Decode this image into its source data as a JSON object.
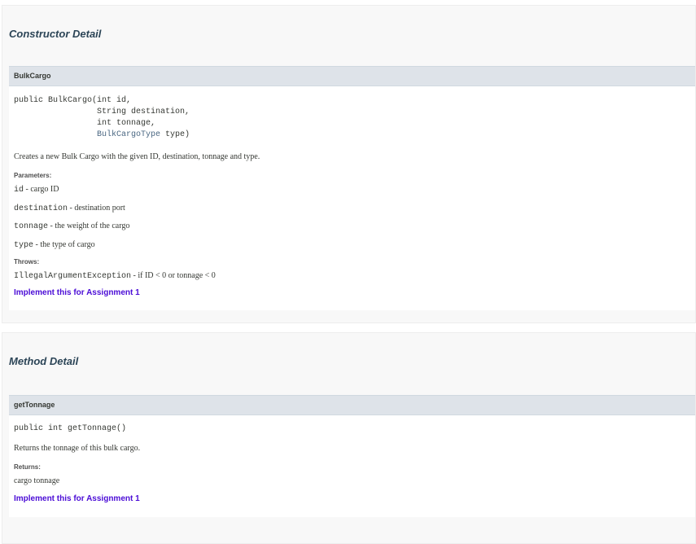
{
  "constructor_section": {
    "title": "Constructor Detail",
    "member": {
      "name": "BulkCargo",
      "signature_lines": [
        "public BulkCargo(int id,",
        "                 String destination,",
        "                 int tonnage,"
      ],
      "signature_last_indent": "                 ",
      "signature_last_type": "BulkCargoType",
      "signature_last_rest": " type)",
      "description": "Creates a new Bulk Cargo with the given ID, destination, tonnage and type.",
      "parameters_label": "Parameters:",
      "parameters": [
        {
          "name": "id",
          "desc": " - cargo ID"
        },
        {
          "name": "destination",
          "desc": " - destination port"
        },
        {
          "name": "tonnage",
          "desc": " - the weight of the cargo"
        },
        {
          "name": "type",
          "desc": " - the type of cargo"
        }
      ],
      "throws_label": "Throws:",
      "throws": {
        "name": "IllegalArgumentException",
        "desc": " - if ID < 0 or tonnage < 0"
      },
      "note": "Implement this for Assignment 1"
    }
  },
  "method_section": {
    "title": "Method Detail",
    "member": {
      "name": "getTonnage",
      "signature": "public int getTonnage()",
      "description": "Returns the tonnage of this bulk cargo.",
      "returns_label": "Returns:",
      "returns": "cargo tonnage",
      "note": "Implement this for Assignment 1"
    }
  }
}
